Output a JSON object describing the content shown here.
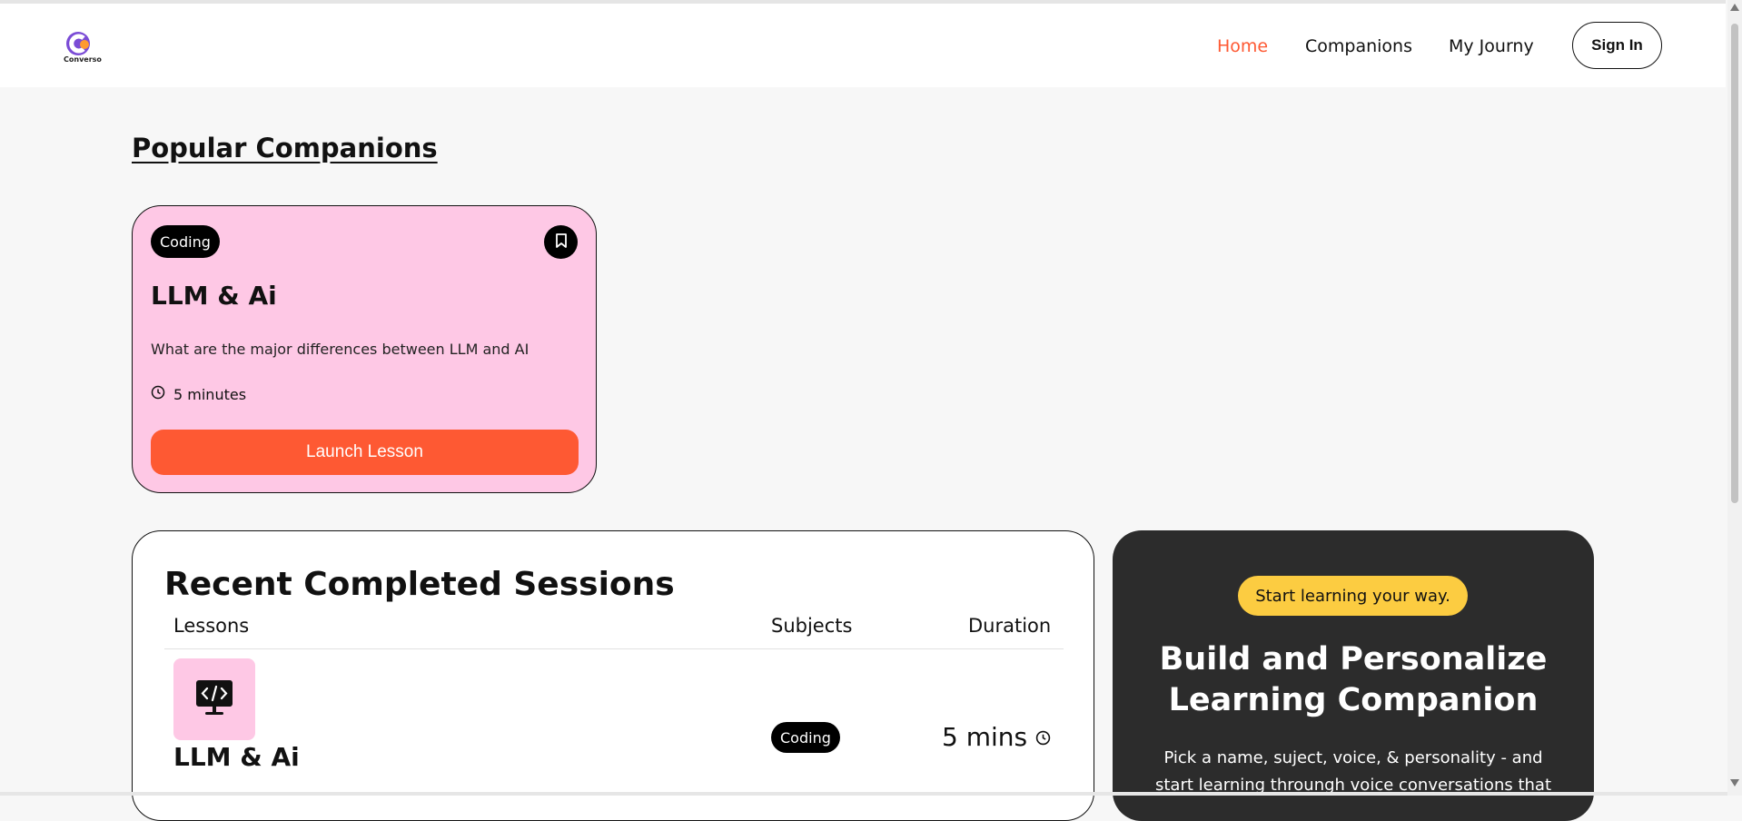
{
  "brand": {
    "logo_text": "Converso",
    "accent_color": "#fe5933"
  },
  "nav": {
    "items": [
      {
        "label": "Home",
        "active": true
      },
      {
        "label": "Companions",
        "active": false
      },
      {
        "label": "My Journy",
        "active": false
      }
    ],
    "signin_label": "Sign In"
  },
  "popular": {
    "title": "Popular Companions",
    "card": {
      "subject": "Coding",
      "title": "LLM & Ai",
      "description": "What are the major differences between LLM and AI",
      "duration": "5 minutes",
      "button_label": "Launch Lesson",
      "bg_color": "#fec8e5",
      "icon": "bookmark-icon"
    }
  },
  "recent": {
    "title": "Recent Completed Sessions",
    "headers": {
      "lessons": "Lessons",
      "subjects": "Subjects",
      "duration": "Duration"
    },
    "rows": [
      {
        "name": "LLM & Ai",
        "subject": "Coding",
        "duration": "5 mins",
        "icon": "code-monitor-icon"
      }
    ]
  },
  "cta": {
    "badge": "Start learning your way.",
    "title_line1": "Build and Personalize",
    "title_line2": "Learning Companion",
    "description_line1": "Pick a name, suject, voice, & personality - and",
    "description_line2": "start learning throungh voice conversations that",
    "badge_color": "#fccc41",
    "bg_color": "#2c2c2c"
  }
}
